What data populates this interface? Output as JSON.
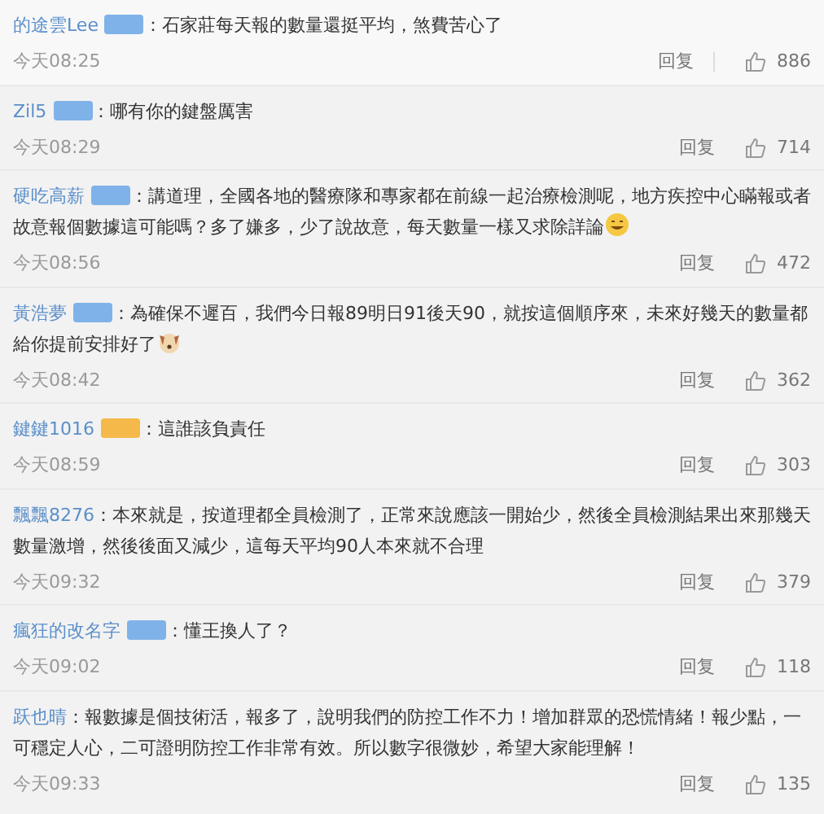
{
  "comments": [
    {
      "user": "的途雲Lee",
      "badge": {
        "color": "#7fb2e8"
      },
      "text": "：石家莊每天報的數量還挺平均，煞費苦心了",
      "time": "今天08:25",
      "reply": "回复",
      "likes": "886",
      "top": true
    },
    {
      "user": "Zil5",
      "badge": {
        "color": "#7fb2e8"
      },
      "text": "：哪有你的鍵盤厲害",
      "time": "今天08:29",
      "reply": "回复",
      "likes": "714",
      "top": false
    },
    {
      "user": "硬吃高薪",
      "badge": {
        "color": "#7fb2e8"
      },
      "text": "：講道理，全國各地的醫療隊和專家都在前線一起治療檢測呢，地方疾控中心瞞報或者故意報個數據這可能嗎？多了嫌多，少了說故意，每天數量一樣又求除詳論",
      "emoji": {
        "kind": "grin"
      },
      "time": "今天08:56",
      "reply": "回复",
      "likes": "472",
      "top": false
    },
    {
      "user": "黃浩夢",
      "badge": {
        "color": "#7fb2e8"
      },
      "text": "：為確保不遲百，我們今日報89明日91後天90，就按這個順序來，未來好幾天的數量都給你提前安排好了",
      "emoji": {
        "kind": "dog"
      },
      "time": "今天08:42",
      "reply": "回复",
      "likes": "362",
      "top": false
    },
    {
      "user": "鍵鍵1016",
      "badge": {
        "color": "#f5b94a"
      },
      "text": "：這誰該負責任",
      "time": "今天08:59",
      "reply": "回复",
      "likes": "303",
      "top": false
    },
    {
      "user": "飄飄8276",
      "text": "：本來就是，按道理都全員檢測了，正常來說應該一開始少，然後全員檢測結果出來那幾天數量激增，然後後面又減少，這每天平均90人本來就不合理",
      "time": "今天09:32",
      "reply": "回复",
      "likes": "379",
      "top": false
    },
    {
      "user": "瘋狂的改名字",
      "badge": {
        "color": "#7fb2e8"
      },
      "text": "：懂王換人了？",
      "time": "今天09:02",
      "reply": "回复",
      "likes": "118",
      "top": false
    },
    {
      "user": "跃也晴",
      "text": "：報數據是個技術活，報多了，說明我們的防控工作不力！增加群眾的恐慌情緒！報少點，一可穩定人心，二可證明防控工作非常有效。所以數字很微妙，希望大家能理解！",
      "time": "今天09:33",
      "reply": "回复",
      "likes": "135",
      "top": false
    }
  ]
}
